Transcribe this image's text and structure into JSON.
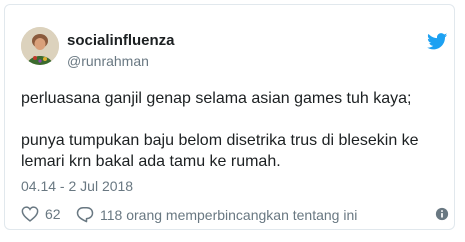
{
  "tweet": {
    "display_name": "socialinfluenza",
    "handle": "@runrahman",
    "lines": [
      "perluasana ganjil genap selama asian games tuh kaya;",
      "punya tumpukan baju belom disetrika trus di blesekin ke lemari krn bakal ada tamu ke rumah."
    ],
    "timestamp": "04.14 - 2 Jul 2018",
    "likes": "62",
    "replies_text": "118 orang memperbincangkan tentang ini"
  },
  "icons": {
    "logo": "twitter-bird-icon",
    "like": "heart-icon",
    "reply": "speech-bubble-icon",
    "info": "info-icon"
  },
  "colors": {
    "twitter_blue": "#1da1f2",
    "text": "#1c2022",
    "muted": "#697882",
    "border": "#e1e8ed"
  }
}
